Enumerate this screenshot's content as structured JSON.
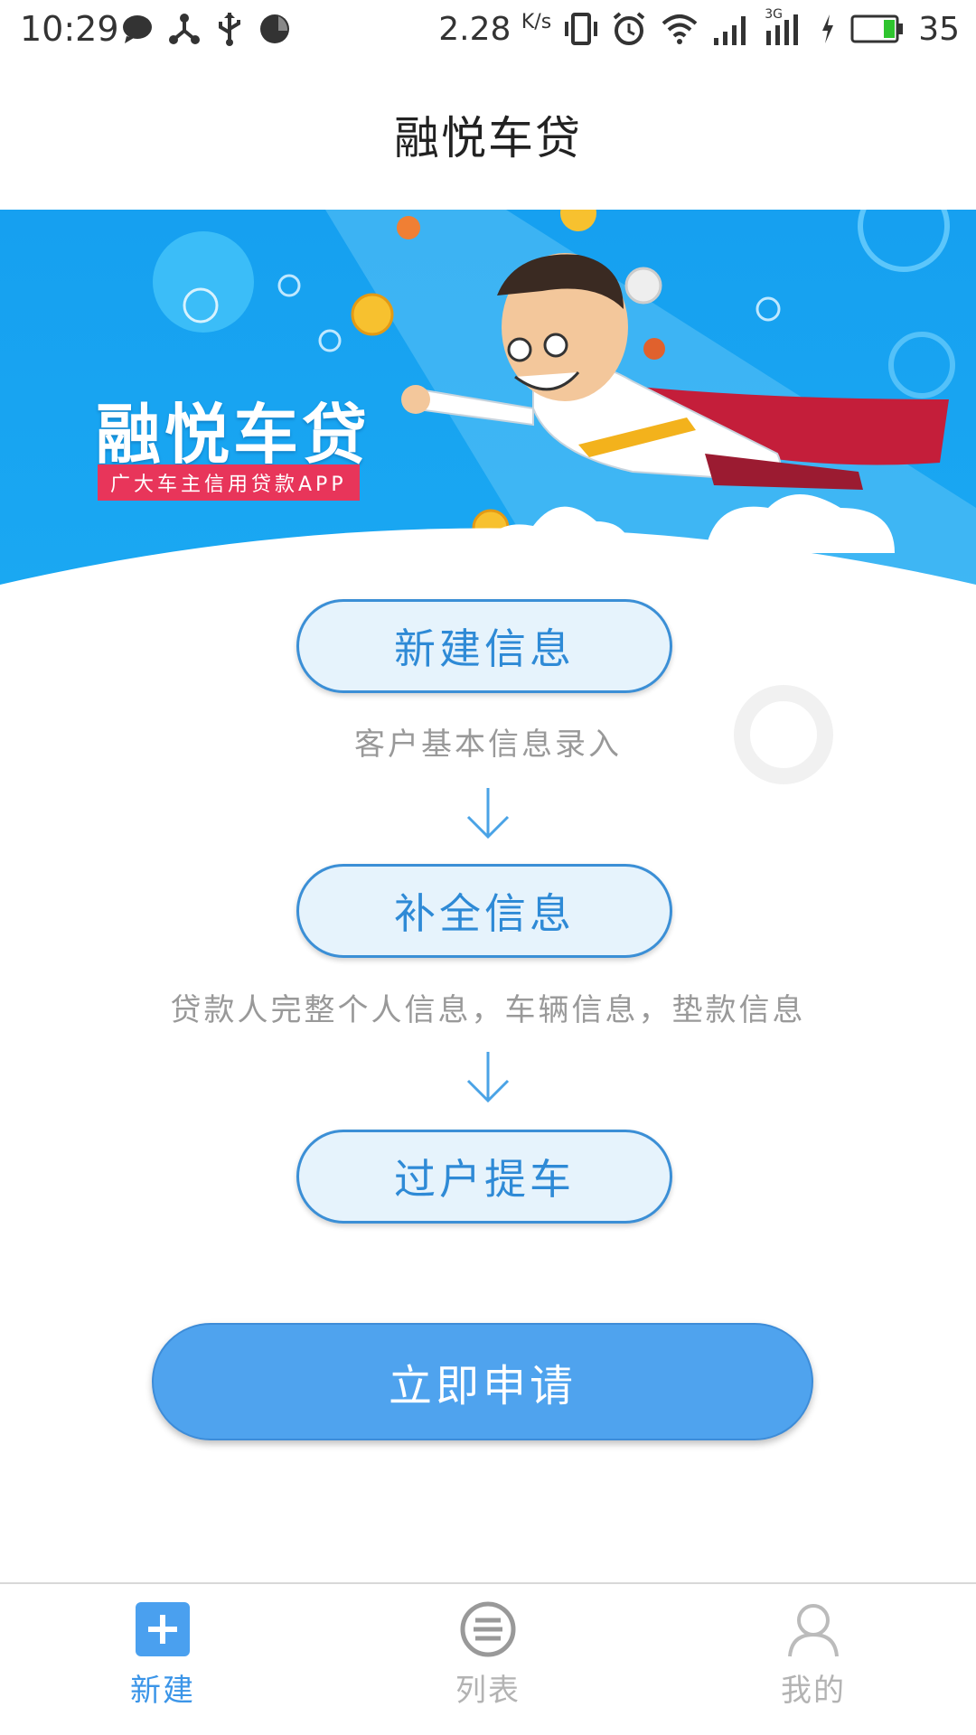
{
  "status_bar": {
    "time": "10:29",
    "net_speed": "2.28",
    "net_unit": "K/s",
    "network_type": "3G",
    "battery": "35",
    "icons": [
      "chat-icon",
      "share-hub-icon",
      "usb-icon",
      "app-dot-icon",
      "vibrate-icon",
      "alarm-icon",
      "wifi-icon",
      "signal-icon",
      "signal-3g-icon",
      "charging-icon",
      "battery-icon"
    ]
  },
  "header": {
    "title": "融悦车贷"
  },
  "banner": {
    "title": "融悦车贷",
    "subtitle": "广大车主信用贷款APP",
    "bg_color": "#1aa2f0"
  },
  "steps": [
    {
      "label": "新建信息",
      "desc": "客户基本信息录入"
    },
    {
      "label": "补全信息",
      "desc": "贷款人完整个人信息，车辆信息，垫款信息"
    },
    {
      "label": "过户提车",
      "desc": ""
    }
  ],
  "apply_button": {
    "label": "立即申请"
  },
  "bottom_nav": {
    "items": [
      {
        "label": "新建",
        "icon": "plus-square-icon",
        "active": true
      },
      {
        "label": "列表",
        "icon": "list-circle-icon",
        "active": false
      },
      {
        "label": "我的",
        "icon": "user-icon",
        "active": false
      }
    ]
  },
  "colors": {
    "accent": "#3b95e8",
    "button_fill": "#4fa3ee",
    "step_border": "#3b8fd6",
    "step_bg": "#e6f3fc",
    "muted_text": "#999999",
    "inactive_nav": "#b3b3b3"
  }
}
